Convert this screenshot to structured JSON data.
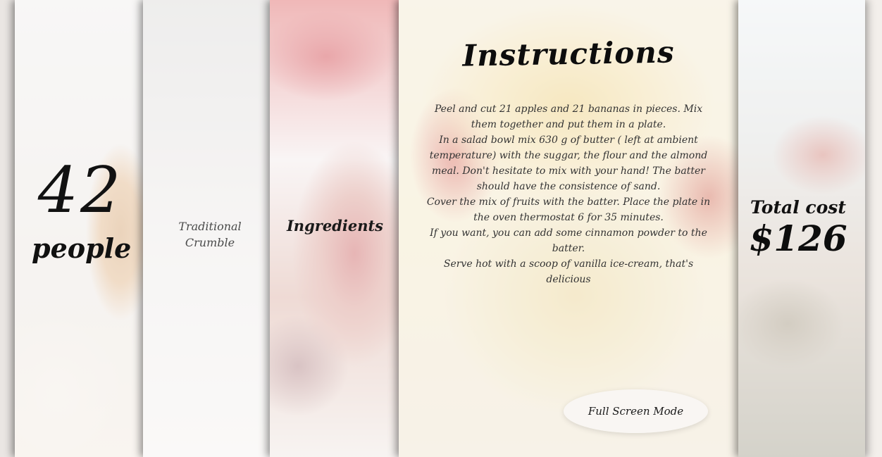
{
  "people": {
    "count": "42",
    "label": "people"
  },
  "dessert": {
    "name": "Traditional Crumble"
  },
  "ingredients": {
    "title": "Ingredients"
  },
  "instructions": {
    "title": "Instructions",
    "paragraphs": [
      "Peel and cut 21 apples and 21 bananas in pieces. Mix them together and put them in a plate.",
      "In a salad bowl mix 630 g of butter ( left at ambient temperature) with the suggar, the flour and the almond meal. Don't hesitate to mix with your hand! The batter should have the consistence of sand.",
      "Cover the mix of fruits with the batter. Place the plate in the oven thermostat 6 for 35 minutes.",
      "If you want, you can add some cinnamon powder to the batter.",
      "Serve hot with a scoop of vanilla ice-cream, that's delicious"
    ]
  },
  "total": {
    "label": "Total cost",
    "value": "$126"
  },
  "fullscreen": {
    "label": "Full Screen Mode"
  },
  "colors": {
    "text_dark": "#111111",
    "text_muted": "#4a4a4a",
    "button_bg": "#f8f6f4"
  }
}
